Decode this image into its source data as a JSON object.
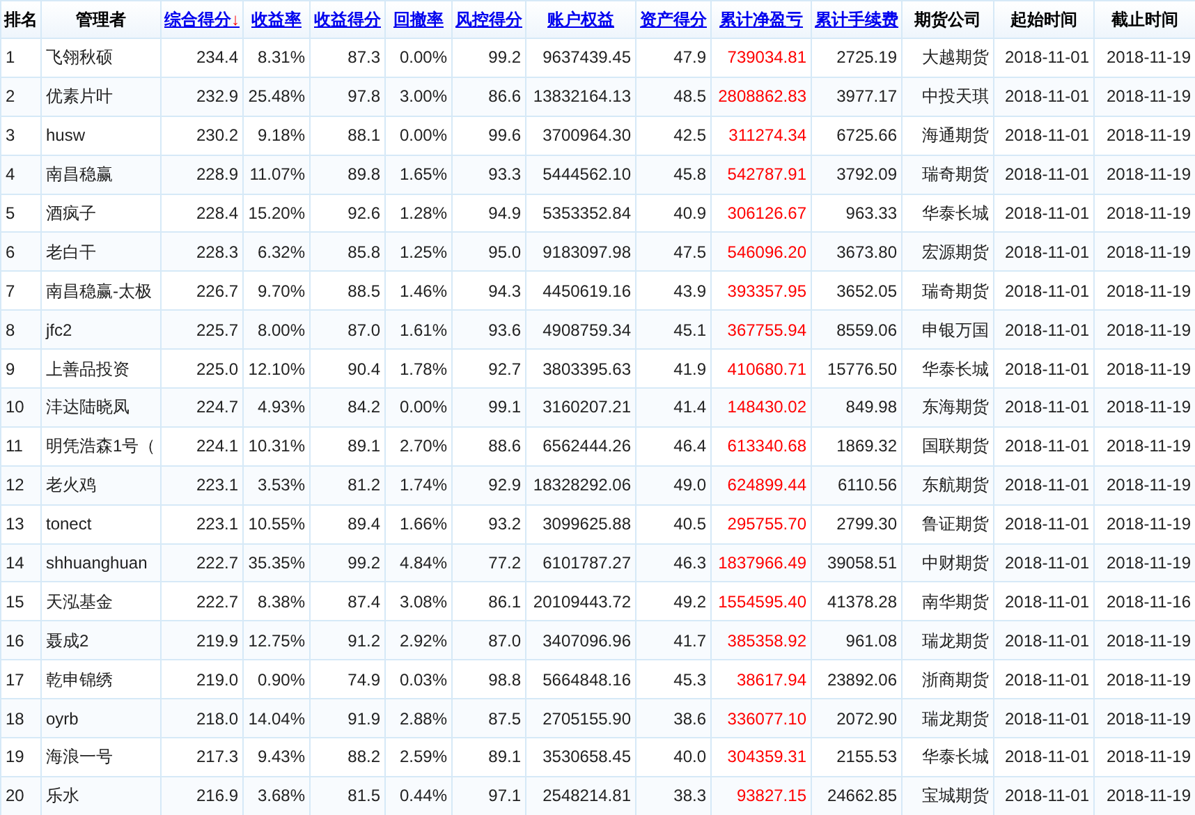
{
  "table": {
    "columns": [
      {
        "label": "排名",
        "kind": "plain"
      },
      {
        "label": "管理者",
        "kind": "plain"
      },
      {
        "label": "综合得分",
        "kind": "link",
        "sort_arrow": "↓"
      },
      {
        "label": "收益率",
        "kind": "link"
      },
      {
        "label": "收益得分",
        "kind": "link"
      },
      {
        "label": "回撤率",
        "kind": "link"
      },
      {
        "label": "风控得分",
        "kind": "link"
      },
      {
        "label": "账户权益",
        "kind": "link"
      },
      {
        "label": "资产得分",
        "kind": "link"
      },
      {
        "label": "累计净盈亏",
        "kind": "link"
      },
      {
        "label": "累计手续费",
        "kind": "link"
      },
      {
        "label": "期货公司",
        "kind": "plain"
      },
      {
        "label": "起始时间",
        "kind": "plain"
      },
      {
        "label": "截止时间",
        "kind": "plain"
      }
    ],
    "rows": [
      [
        "1",
        "飞翎秋硕",
        "234.4",
        "8.31%",
        "87.3",
        "0.00%",
        "99.2",
        "9637439.45",
        "47.9",
        "739034.81",
        "2725.19",
        "大越期货",
        "2018-11-01",
        "2018-11-19"
      ],
      [
        "2",
        "优素片叶",
        "232.9",
        "25.48%",
        "97.8",
        "3.00%",
        "86.6",
        "13832164.13",
        "48.5",
        "2808862.83",
        "3977.17",
        "中投天琪",
        "2018-11-01",
        "2018-11-19"
      ],
      [
        "3",
        "husw",
        "230.2",
        "9.18%",
        "88.1",
        "0.00%",
        "99.6",
        "3700964.30",
        "42.5",
        "311274.34",
        "6725.66",
        "海通期货",
        "2018-11-01",
        "2018-11-19"
      ],
      [
        "4",
        "南昌稳赢",
        "228.9",
        "11.07%",
        "89.8",
        "1.65%",
        "93.3",
        "5444562.10",
        "45.8",
        "542787.91",
        "3792.09",
        "瑞奇期货",
        "2018-11-01",
        "2018-11-19"
      ],
      [
        "5",
        "酒疯子",
        "228.4",
        "15.20%",
        "92.6",
        "1.28%",
        "94.9",
        "5353352.84",
        "40.9",
        "306126.67",
        "963.33",
        "华泰长城",
        "2018-11-01",
        "2018-11-19"
      ],
      [
        "6",
        "老白干",
        "228.3",
        "6.32%",
        "85.8",
        "1.25%",
        "95.0",
        "9183097.98",
        "47.5",
        "546096.20",
        "3673.80",
        "宏源期货",
        "2018-11-01",
        "2018-11-19"
      ],
      [
        "7",
        "南昌稳赢-太极",
        "226.7",
        "9.70%",
        "88.5",
        "1.46%",
        "94.3",
        "4450619.16",
        "43.9",
        "393357.95",
        "3652.05",
        "瑞奇期货",
        "2018-11-01",
        "2018-11-19"
      ],
      [
        "8",
        "jfc2",
        "225.7",
        "8.00%",
        "87.0",
        "1.61%",
        "93.6",
        "4908759.34",
        "45.1",
        "367755.94",
        "8559.06",
        "申银万国",
        "2018-11-01",
        "2018-11-19"
      ],
      [
        "9",
        "上善品投资",
        "225.0",
        "12.10%",
        "90.4",
        "1.78%",
        "92.7",
        "3803395.63",
        "41.9",
        "410680.71",
        "15776.50",
        "华泰长城",
        "2018-11-01",
        "2018-11-19"
      ],
      [
        "10",
        "沣达陆晓凤",
        "224.7",
        "4.93%",
        "84.2",
        "0.00%",
        "99.1",
        "3160207.21",
        "41.4",
        "148430.02",
        "849.98",
        "东海期货",
        "2018-11-01",
        "2018-11-19"
      ],
      [
        "11",
        "明凭浩森1号（",
        "224.1",
        "10.31%",
        "89.1",
        "2.70%",
        "88.6",
        "6562444.26",
        "46.4",
        "613340.68",
        "1869.32",
        "国联期货",
        "2018-11-01",
        "2018-11-19"
      ],
      [
        "12",
        "老火鸡",
        "223.1",
        "3.53%",
        "81.2",
        "1.74%",
        "92.9",
        "18328292.06",
        "49.0",
        "624899.44",
        "6110.56",
        "东航期货",
        "2018-11-01",
        "2018-11-19"
      ],
      [
        "13",
        "tonect",
        "223.1",
        "10.55%",
        "89.4",
        "1.66%",
        "93.2",
        "3099625.88",
        "40.5",
        "295755.70",
        "2799.30",
        "鲁证期货",
        "2018-11-01",
        "2018-11-19"
      ],
      [
        "14",
        "shhuanghuan",
        "222.7",
        "35.35%",
        "99.2",
        "4.84%",
        "77.2",
        "6101787.27",
        "46.3",
        "1837966.49",
        "39058.51",
        "中财期货",
        "2018-11-01",
        "2018-11-19"
      ],
      [
        "15",
        "天泓基金",
        "222.7",
        "8.38%",
        "87.4",
        "3.08%",
        "86.1",
        "20109443.72",
        "49.2",
        "1554595.40",
        "41378.28",
        "南华期货",
        "2018-11-01",
        "2018-11-16"
      ],
      [
        "16",
        "聂成2",
        "219.9",
        "12.75%",
        "91.2",
        "2.92%",
        "87.0",
        "3407096.96",
        "41.7",
        "385358.92",
        "961.08",
        "瑞龙期货",
        "2018-11-01",
        "2018-11-19"
      ],
      [
        "17",
        "乾申锦绣",
        "219.0",
        "0.90%",
        "74.9",
        "0.03%",
        "98.8",
        "5664848.16",
        "45.3",
        "38617.94",
        "23892.06",
        "浙商期货",
        "2018-11-01",
        "2018-11-19"
      ],
      [
        "18",
        "oyrb",
        "218.0",
        "14.04%",
        "91.9",
        "2.88%",
        "87.5",
        "2705155.90",
        "38.6",
        "336077.10",
        "2072.90",
        "瑞龙期货",
        "2018-11-01",
        "2018-11-19"
      ],
      [
        "19",
        "海浪一号",
        "217.3",
        "9.43%",
        "88.2",
        "2.59%",
        "89.1",
        "3530658.45",
        "40.0",
        "304359.31",
        "2155.53",
        "华泰长城",
        "2018-11-01",
        "2018-11-19"
      ],
      [
        "20",
        "乐水",
        "216.9",
        "3.68%",
        "81.5",
        "0.44%",
        "97.1",
        "2548214.81",
        "38.3",
        "93827.15",
        "24662.85",
        "宝城期货",
        "2018-11-01",
        "2018-11-19"
      ]
    ]
  }
}
